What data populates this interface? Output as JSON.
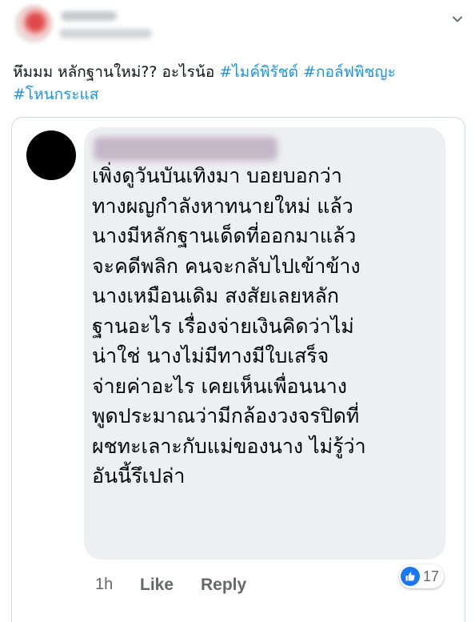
{
  "tweet": {
    "text_line1_plain": "หึมมม หลักฐานใหม่??  อะไรน้อ ",
    "hashtags": [
      "#ไมค์พิรัชต์",
      "#กอล์ฟพิชญะ",
      "#โหนกระแส"
    ],
    "icons": {
      "menu": "chevron-down-icon"
    }
  },
  "comment": {
    "lines": [
      "เพิ่งดูวันบันเทิงมา บอยบอกว่า",
      "ทางผญกำลังหาทนายใหม่ แล้ว",
      "นางมีหลักฐานเด็ดที่ออกมาแล้ว",
      "จะคดีพลิก คนจะกลับไปเข้าข้าง",
      "นางเหมือนเดิม สงสัยเลยหลัก",
      "ฐานอะไร เรื่องจ่ายเงินคิดว่าไม่",
      "น่าใช่ นางไม่มีทางมีใบเสร็จ",
      "จ่ายค่าอะไร เคยเห็นเพื่อนนาง",
      "พูดประมาณว่ามีกล้องวงจรปิดที่",
      "ผชทะเลาะกับแม่ของนาง ไม่รู้ว่า",
      "อันนี้รึเปล่า"
    ],
    "time": "1h",
    "like_label": "Like",
    "reply_label": "Reply",
    "reaction_count": "17",
    "colors": {
      "bubble": "#eeeff2",
      "meta": "#65676b",
      "like_blue": "#1877f2"
    }
  },
  "colors": {
    "hashtag": "#1b95e0",
    "text": "#0f1419",
    "card_border": "#cfd9de"
  }
}
